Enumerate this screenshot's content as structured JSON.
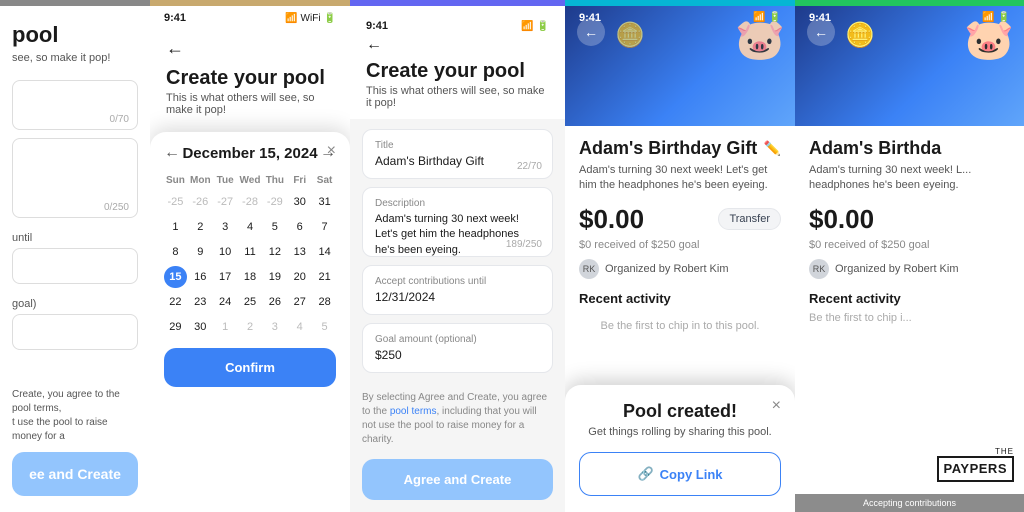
{
  "screens": {
    "screen1": {
      "topBarColor": "#888888",
      "title": "pool",
      "subtitle": "see, so make it pop!",
      "charCount1": "0/70",
      "charCount2": "0/250",
      "until": "until",
      "goal": "goal)",
      "checkboxText": "Create, you agree to the pool terms,",
      "checkboxSub": "t use the pool to raise money for a",
      "btnLabel": "ee and Create"
    },
    "screen2": {
      "topBarColor": "#c8a96e",
      "time": "9:41",
      "backLabel": "←",
      "title": "Create your pool",
      "subtitle": "This is what others will see, so make it pop!",
      "calendarMonth": "December 15, 2024",
      "daysOfWeek": [
        "Sun",
        "Mon",
        "Tue",
        "Wed",
        "Thu",
        "Fri",
        "Sat"
      ],
      "closeLabel": "×",
      "confirmLabel": "Confirm",
      "weeks": [
        [
          "-25",
          "-26",
          "-27",
          "-28",
          "-29",
          "30",
          "31"
        ],
        [
          "1",
          "2",
          "3",
          "4",
          "5",
          "6",
          "7"
        ],
        [
          "8",
          "9",
          "10",
          "11",
          "12",
          "13",
          "14"
        ],
        [
          "15",
          "16",
          "17",
          "18",
          "19",
          "20",
          "21"
        ],
        [
          "22",
          "23",
          "24",
          "25",
          "26",
          "27",
          "28"
        ],
        [
          "29",
          "30",
          "1",
          "2",
          "3",
          "4",
          "5"
        ]
      ],
      "selectedDay": "15",
      "prevDays": [
        "-25",
        "-26",
        "-27",
        "-28",
        "-29"
      ],
      "nextDays": [
        "1",
        "2",
        "3",
        "4",
        "5"
      ]
    },
    "screen3": {
      "topBarColor": "#6366f1",
      "time": "9:41",
      "title": "Create your pool",
      "subtitle": "This is what others will see, so make it pop!",
      "titleLabel": "Title",
      "titleValue": "Adam's Birthday Gift",
      "titleCount": "22/70",
      "descLabel": "Description",
      "descValue": "Adam's turning 30 next week! Let's get him the headphones he's been eyeing.",
      "descCount": "189/250",
      "untilLabel": "Accept contributions until",
      "untilValue": "12/31/2024",
      "goalLabel": "Goal amount (optional)",
      "goalValue": "$250",
      "footerText": "By selecting Agree and Create, you agree to the ",
      "footerLink": "pool terms",
      "footerText2": ", including that you will not use the pool to raise money for a charity.",
      "btnLabel": "Agree and Create"
    },
    "screen4": {
      "topBarColor": "#06b6d4",
      "time": "9:41",
      "poolTitle": "Adam's Birthday Gift",
      "poolDesc": "Adam's turning 30 next week! Let's get him the headphones he's been eyeing.",
      "amount": "$0.00",
      "goal": "$0 received of $250 goal",
      "organizer": "Organized by Robert Kim",
      "recentActivity": "Recent activity",
      "activityEmpty": "Be the first to chip in to this pool.",
      "transferLabel": "Transfer",
      "modalTitle": "Pool created!",
      "modalSubtitle": "Get things rolling by sharing this pool.",
      "copyLinkLabel": "Copy Link",
      "closeLabel": "×"
    },
    "screen5": {
      "topBarColor": "#22c55e",
      "time": "9:41",
      "poolTitle": "Adam's Birthda",
      "poolDesc": "Adam's turning 30 next week! L... headphones he's been eyeing.",
      "amount": "$0.00",
      "goal": "$0 received of $250 goal",
      "organizer": "Organized by Robert Kim",
      "recentActivity": "Recent activity",
      "activityEmpty": "Be the first to chip i...",
      "acceptingBadge": "Accepting contributions"
    }
  },
  "watermark": {
    "the": "THE",
    "brand": "PAYPERS"
  }
}
